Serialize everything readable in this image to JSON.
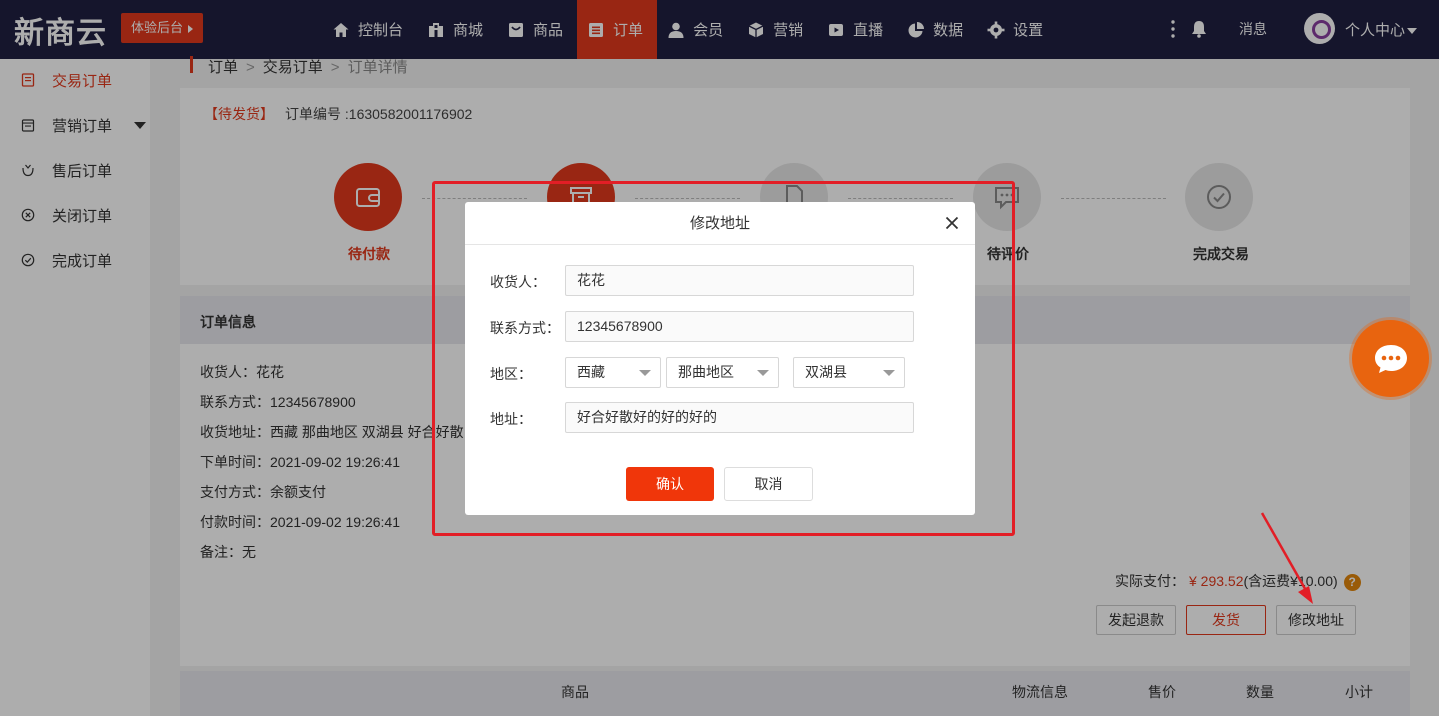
{
  "brand": {
    "logo": "新商云",
    "trial_button": "体验后台",
    "accent": "#e2391c",
    "topbar_bg": "#1f1f42"
  },
  "nav": {
    "items": [
      {
        "label": "控制台",
        "icon": "home-icon"
      },
      {
        "label": "商城",
        "icon": "building-icon"
      },
      {
        "label": "商品",
        "icon": "cart-icon"
      },
      {
        "label": "订单",
        "icon": "list-icon",
        "active": true
      },
      {
        "label": "会员",
        "icon": "user-icon"
      },
      {
        "label": "营销",
        "icon": "cube-icon"
      },
      {
        "label": "直播",
        "icon": "video-icon"
      },
      {
        "label": "数据",
        "icon": "pie-icon"
      },
      {
        "label": "设置",
        "icon": "gear-icon"
      }
    ],
    "messages": "消息",
    "user_center": "个人中心"
  },
  "sidebar": {
    "items": [
      {
        "label": "交易订单",
        "active": true
      },
      {
        "label": "营销订单",
        "has_children": true
      },
      {
        "label": "售后订单"
      },
      {
        "label": "关闭订单"
      },
      {
        "label": "完成订单"
      }
    ]
  },
  "breadcrumb": {
    "a": "订单",
    "b": "交易订单",
    "c": "订单详情",
    "sep": ">"
  },
  "order": {
    "status_tag": "【待发货】",
    "number_label": "订单编号 :1630582001176902",
    "steps": {
      "s1": "待付款",
      "s4": "待评价",
      "s5": "完成交易"
    }
  },
  "info": {
    "title": "订单信息",
    "receiver": "收货人：花花",
    "phone": "联系方式：12345678900",
    "address": "收货地址：西藏 那曲地区 双湖县 好合好散",
    "order_time": "下单时间：2021-09-02 19:26:41",
    "pay_method": "支付方式：余额支付",
    "pay_time": "付款时间：2021-09-02 19:26:41",
    "remark": "备注：无"
  },
  "payment": {
    "label": "实际支付：",
    "amount": "¥ 293.52",
    "freight": "(含运费¥10.00)",
    "help": "?"
  },
  "actions": {
    "refund": "发起退款",
    "ship": "发货",
    "edit_address": "修改地址"
  },
  "table": {
    "goods": "商品",
    "logistics": "物流信息",
    "price": "售价",
    "qty": "数量",
    "subtotal": "小计"
  },
  "dialog": {
    "title": "修改地址",
    "receiver_label": "收货人：",
    "receiver_value": "花花",
    "phone_label": "联系方式：",
    "phone_value": "12345678900",
    "region_label": "地区：",
    "province": "西藏",
    "city": "那曲地区",
    "county": "双湖县",
    "address_label": "地址：",
    "address_value": "好合好散好的好的好的",
    "confirm": "确认",
    "cancel": "取消"
  }
}
